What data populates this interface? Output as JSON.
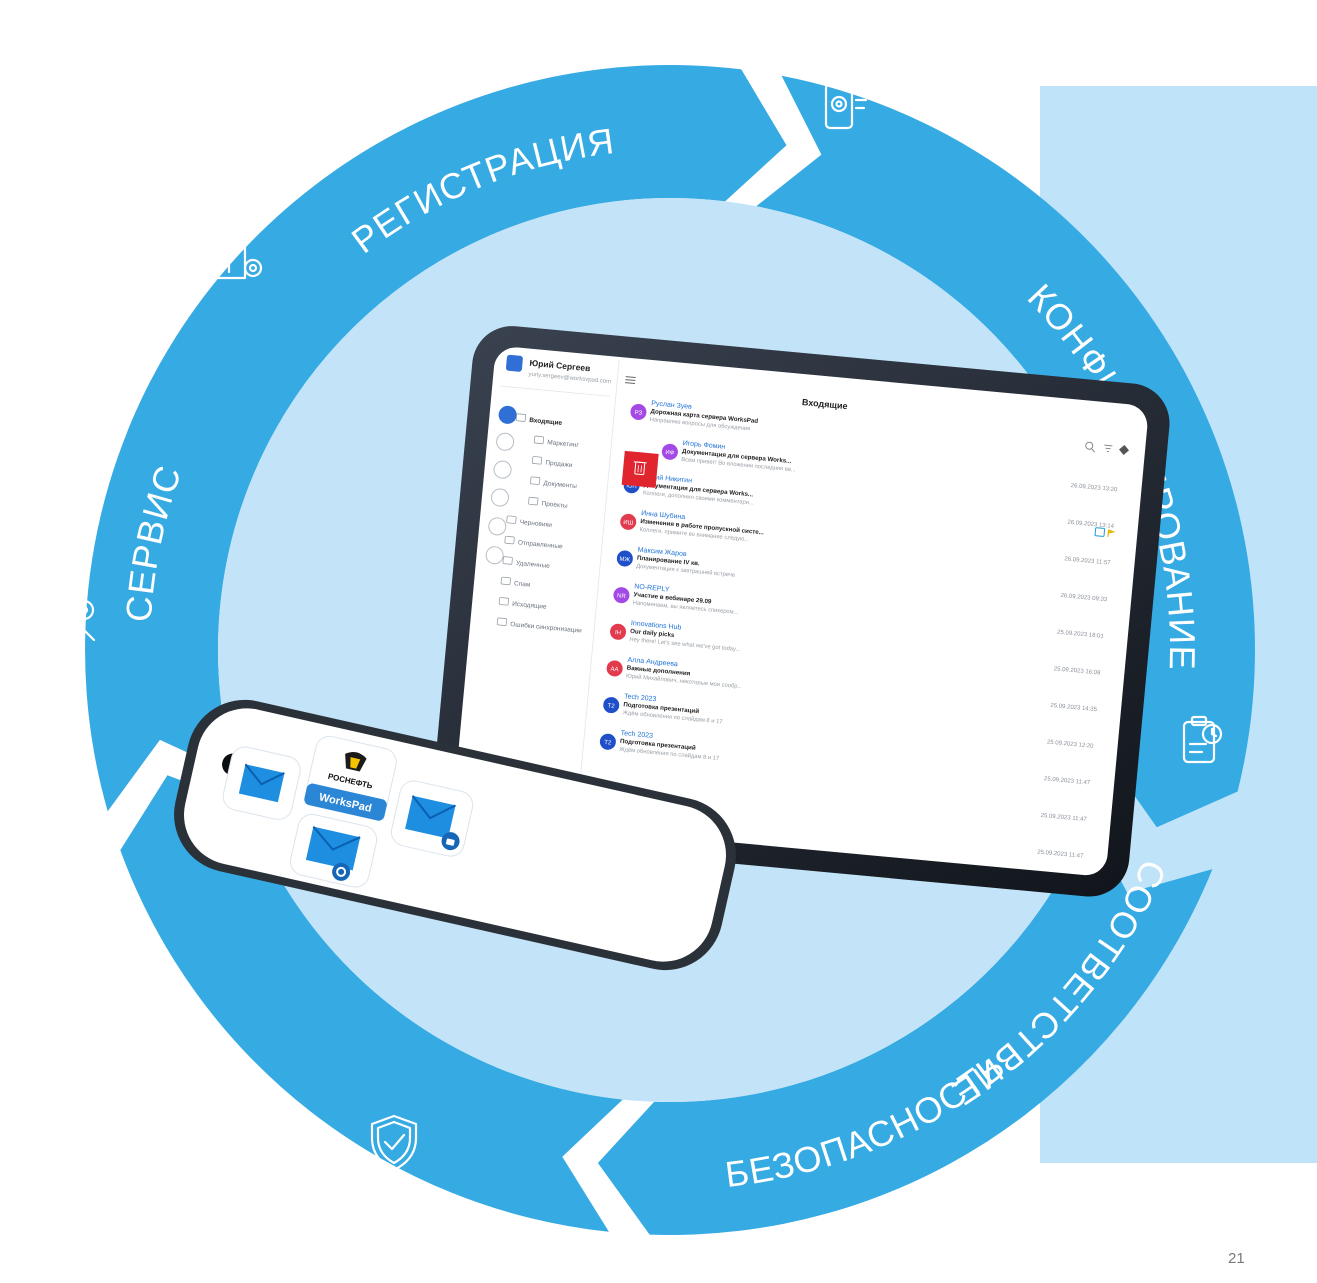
{
  "slide": {
    "page_number": "21"
  },
  "colors": {
    "arrow_blue": "#35aae3",
    "panel_light": "#bfe3f8",
    "text_blue": "#1f73d6",
    "avatar_palette": [
      "#a349e6",
      "#e23b4e",
      "#1f4fc9",
      "#1976d2"
    ]
  },
  "cycle": {
    "stages": [
      {
        "label": "РЕГИСТРАЦИЯ",
        "icon": "document-settings-icon"
      },
      {
        "label": "КОНФИГУРИРОВАНИЕ",
        "icon": "smartphone-gear-icon"
      },
      {
        "label": "СООТВЕТСТВИЕ",
        "icon": "clipboard-checklist-icon"
      },
      {
        "label": "БЕЗОПАСНОСТЬ",
        "icon": "shield-check-icon"
      },
      {
        "label": "СЕРВИС",
        "icon": "wrench-gear-icon"
      }
    ]
  },
  "tablet": {
    "user": {
      "name": "Юрий Сергеев",
      "email": "yuriy.sergeev@worksvpad.com"
    },
    "header_title": "Входящие",
    "folders": [
      "Входящие",
      "Маркетинг",
      "Продажи",
      "Документы",
      "Проекты",
      "Черновики",
      "Отправленные",
      "Удаленные",
      "Спам",
      "Исходящие",
      "Ошибки синхронизации"
    ],
    "messages": [
      {
        "initials": "РЗ",
        "sender": "Руслан Зуев",
        "subject": "Дорожная карта сервера WorksPad",
        "preview": "Направляю вопросы для обсуждения",
        "date": ""
      },
      {
        "initials": "ИФ",
        "sender": "Игорь Фомин",
        "subject": "Документация для сервера Works...",
        "preview": "Всем привет! Во вложении последняя ве...",
        "date": "26.09.2023 13:20"
      },
      {
        "initials": "ЮН",
        "sender": "Юрий Никитин",
        "subject": "Документация для сервера Works...",
        "preview": "Коллеги, дополнил своими комментари...",
        "date": "26.09.2023 13:14"
      },
      {
        "initials": "ИШ",
        "sender": "Инна Шубина",
        "subject": "Изменения в работе пропускной систе...",
        "preview": "Коллеги, примите во внимание следую...",
        "date": "26.09.2023 11:57"
      },
      {
        "initials": "МЖ",
        "sender": "Максим Жаров",
        "subject": "Планирование IV кв.",
        "preview": "Документация к завтрашней встрече",
        "date": "26.09.2023 09:33"
      },
      {
        "initials": "NR",
        "sender": "NO-REPLY",
        "subject": "Участие в вебинаре 29.09",
        "preview": "Напоминаем, вы являетесь спикером...",
        "date": "25.09.2023 18:01"
      },
      {
        "initials": "IH",
        "sender": "Innovations Hub",
        "subject": "Our daily picks",
        "preview": "Hey there! Let's see what we've got today...",
        "date": "25.09.2023 16:08"
      },
      {
        "initials": "АА",
        "sender": "Алла Андреева",
        "subject": "Важные дополнения",
        "preview": "Юрий Михайлович, некоторые мои сообр...",
        "date": "25.09.2023 14:35"
      },
      {
        "initials": "T2",
        "sender": "Tech 2023",
        "subject": "Подготовка презентаций",
        "preview": "Ждём обновления по слайдам 8 и 17",
        "date": "25.09.2023 12:20"
      },
      {
        "initials": "T2",
        "sender": "Tech 2023",
        "subject": "Подготовка презентаций",
        "preview": "Ждём обновления по слайдам 8 и 17",
        "date": "25.09.2023 11:47"
      },
      {
        "initials": "",
        "sender": "",
        "subject": "",
        "preview": "",
        "date": "25.09.2023 11:47"
      },
      {
        "initials": "",
        "sender": "",
        "subject": "",
        "preview": "",
        "date": "25.09.2023 11:47"
      }
    ]
  },
  "phone": {
    "tiles": [
      {
        "label": "РОСНЕФТЬ",
        "icon": "rosneft-logo-icon"
      },
      {
        "label": "WorksPad",
        "icon": "workspad-banner"
      },
      {
        "label": "",
        "icon": "mail-app-icon"
      },
      {
        "label": "",
        "icon": "mail-lock-app-icon"
      },
      {
        "label": "",
        "icon": "mail-settings-app-icon"
      }
    ]
  }
}
